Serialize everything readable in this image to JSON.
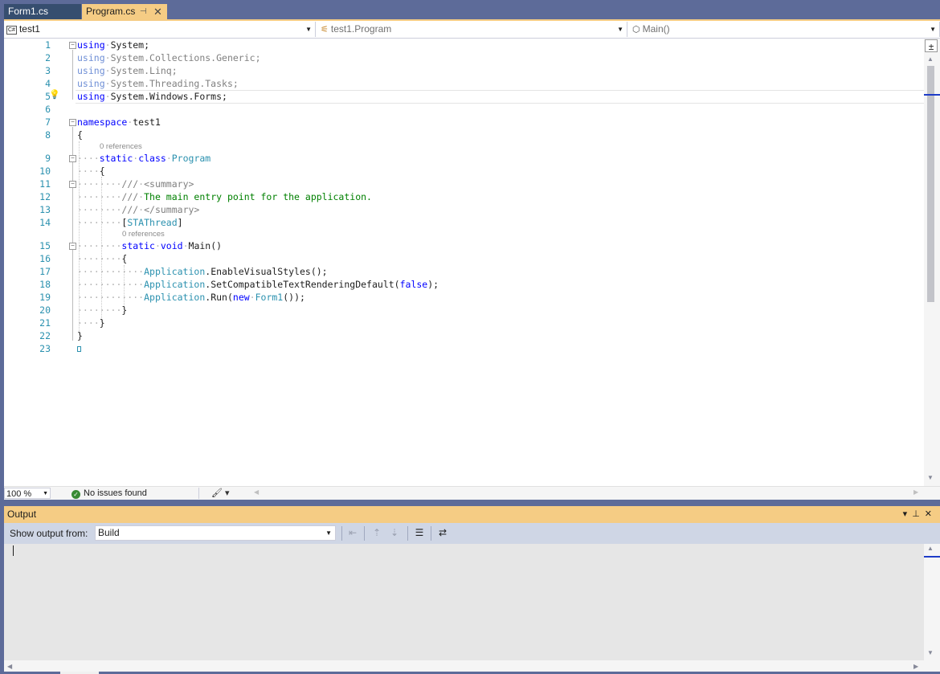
{
  "tabs": [
    {
      "label": "Form1.cs"
    },
    {
      "label": "Program.cs",
      "pin_icon": "pin-icon",
      "close_icon": "close-icon"
    }
  ],
  "nav": {
    "project_badge": "C#",
    "project": "test1",
    "type": "test1.Program",
    "member": "Main()"
  },
  "editor": {
    "line_numbers": [
      "1",
      "2",
      "3",
      "4",
      "5",
      "6",
      "7",
      "8",
      "9",
      "10",
      "11",
      "12",
      "13",
      "14",
      "15",
      "16",
      "17",
      "18",
      "19",
      "20",
      "21",
      "22",
      "23"
    ],
    "references_label": "0 references",
    "code": {
      "l1_kw": "using",
      "l1_rest": "System;",
      "l2_kw": "using",
      "l2_rest": "System.Collections.Generic;",
      "l3_kw": "using",
      "l3_rest": "System.Linq;",
      "l4_kw": "using",
      "l4_rest": "System.Threading.Tasks;",
      "l5_kw": "using",
      "l5_rest": "System.Windows.Forms;",
      "l7_kw": "namespace",
      "l7_rest": "test1",
      "l8": "{",
      "l9_kw1": "static",
      "l9_kw2": "class",
      "l9_type": "Program",
      "l10": "{",
      "l11_a": "///",
      "l11_b": "<summary>",
      "l12_a": "///",
      "l12_b": "The main entry point for the application.",
      "l13_a": "///",
      "l13_b": "</summary>",
      "l14_open": "[",
      "l14_type": "STAThread",
      "l14_close": "]",
      "l15_kw1": "static",
      "l15_kw2": "void",
      "l15_rest": "Main()",
      "l16": "{",
      "l17_type": "Application",
      "l17_rest": ".EnableVisualStyles();",
      "l18_type": "Application",
      "l18_rest": ".SetCompatibleTextRenderingDefault(",
      "l18_kw": "false",
      "l18_end": ");",
      "l19_type": "Application",
      "l19_rest": ".Run(",
      "l19_kw": "new",
      "l19_type2": "Form1",
      "l19_end": "());",
      "l20": "}",
      "l21": "}",
      "l22": "}"
    }
  },
  "status": {
    "zoom": "100 %",
    "issues": "No issues found"
  },
  "output": {
    "title": "Output",
    "show_from_label": "Show output from:",
    "source": "Build"
  },
  "colors": {
    "keyword": "#0000ff",
    "type": "#2b91af",
    "comment": "#008000",
    "accent_tab": "#f5cc84",
    "chrome": "#5d6b99"
  }
}
